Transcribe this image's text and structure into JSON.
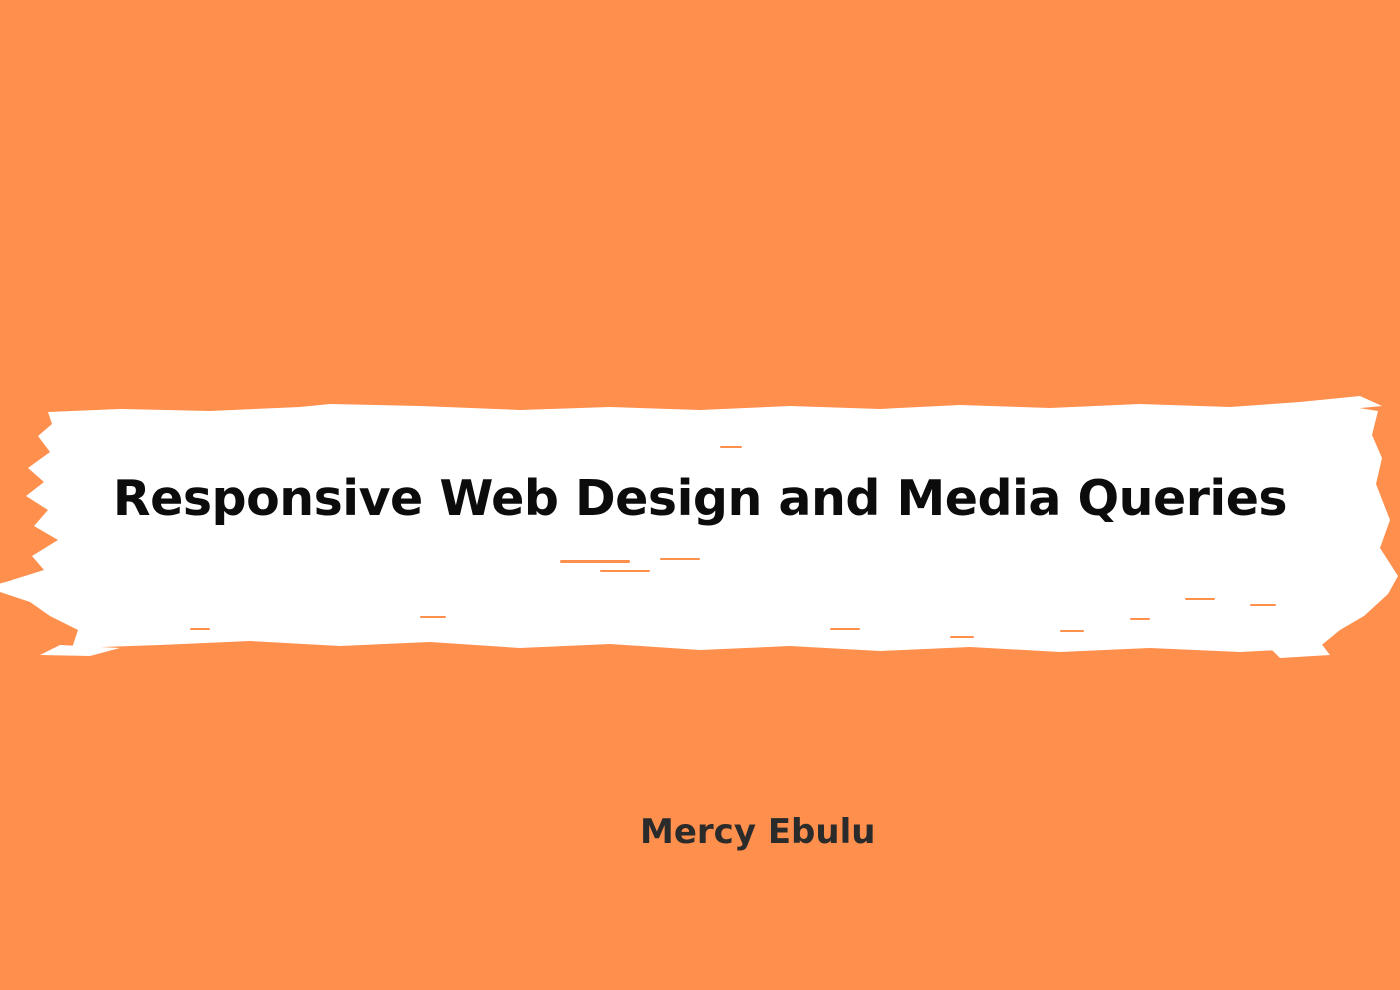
{
  "cover": {
    "title": "Responsive Web Design and Media Queries",
    "author": "Mercy Ebulu"
  },
  "colors": {
    "background": "#ff8f4d",
    "brush": "#ffffff",
    "title_text": "#0c0c0c",
    "author_text": "#2b2b2b"
  }
}
